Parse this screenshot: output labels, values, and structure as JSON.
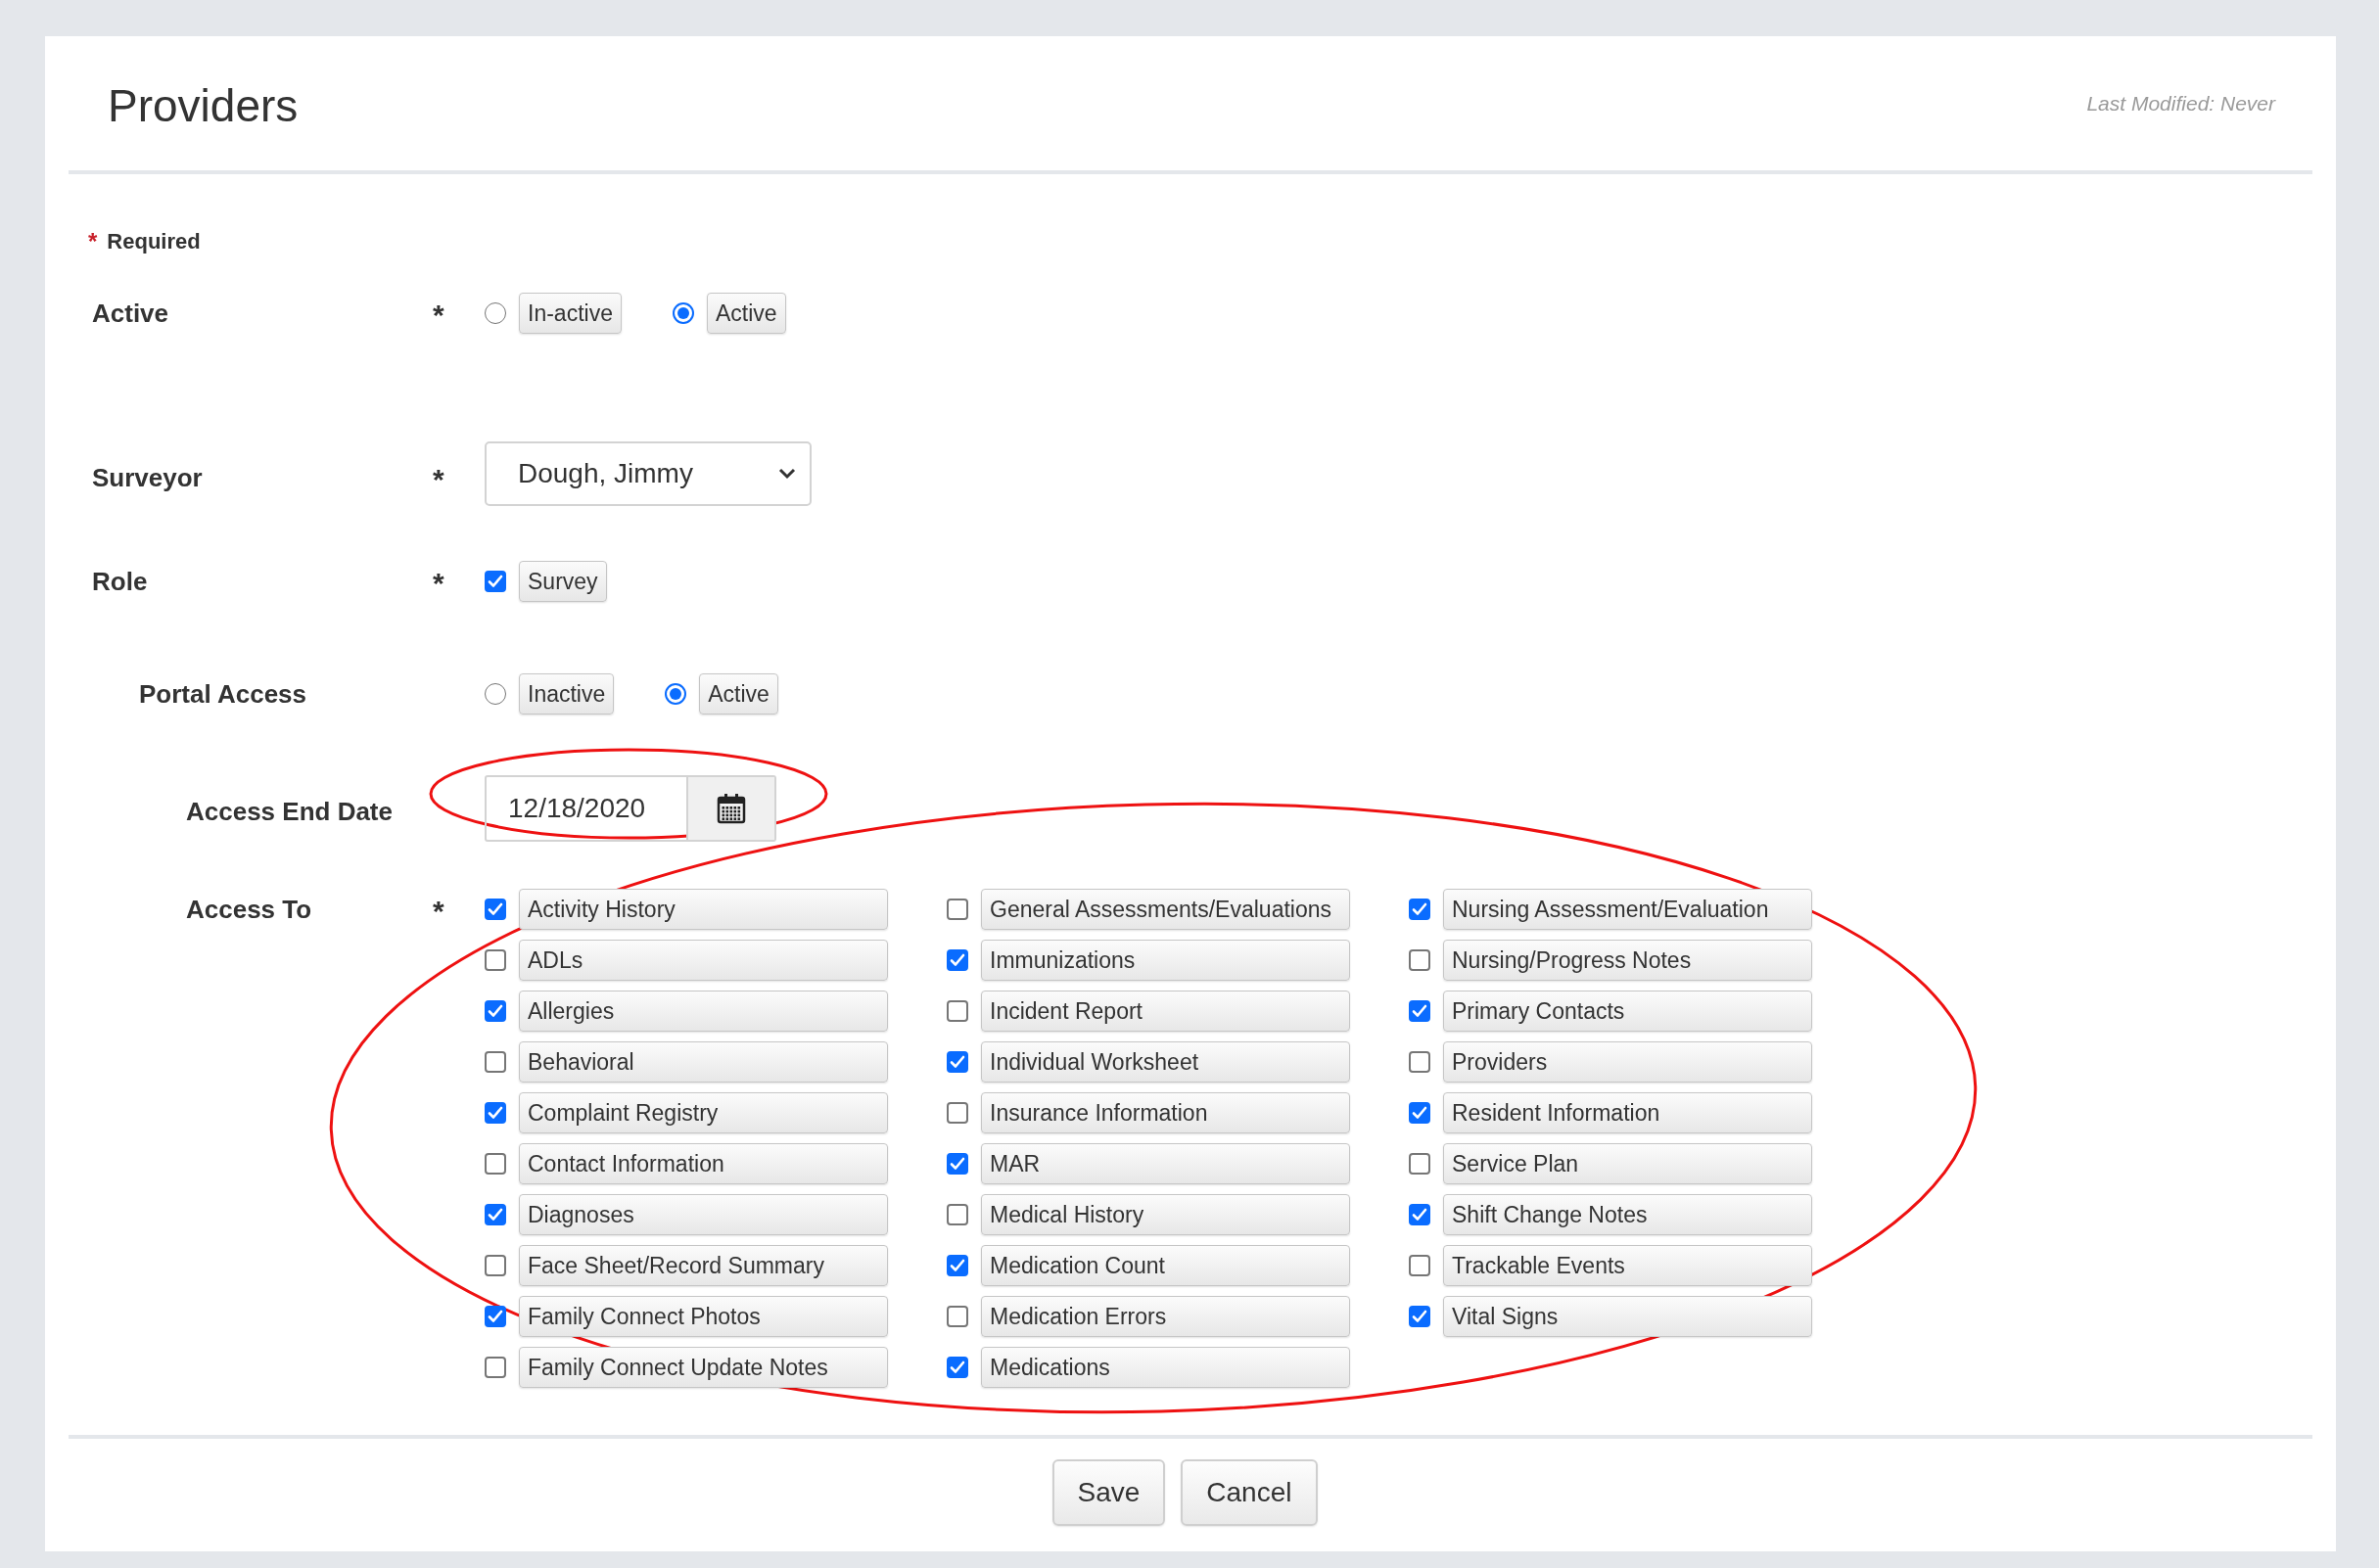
{
  "header": {
    "title": "Providers",
    "last_modified": "Last Modified: Never"
  },
  "required_note": {
    "mark": "*",
    "label": "Required"
  },
  "fields": [
    {
      "kind": "radio",
      "label": "Active",
      "required_mark": "*",
      "options": [
        {
          "label": "In-active",
          "selected": false
        },
        {
          "label": "Active",
          "selected": true
        }
      ]
    },
    {
      "kind": "select",
      "label": "Surveyor",
      "required_mark": "*",
      "value": "Dough, Jimmy"
    },
    {
      "kind": "checkbox",
      "label": "Role",
      "required_mark": "*",
      "options": [
        {
          "label": "Survey",
          "checked": true
        }
      ],
      "children": [
        {
          "kind": "radio",
          "label": "Portal Access",
          "options": [
            {
              "label": "Inactive",
              "selected": false
            },
            {
              "label": "Active",
              "selected": true
            }
          ],
          "children": [
            {
              "kind": "date",
              "label": "Access End Date",
              "value": "12/18/2020"
            },
            {
              "kind": "checkgrid",
              "label": "Access To",
              "required_mark": "*",
              "options": [
                {
                  "label": "Activity History",
                  "checked": true
                },
                {
                  "label": "ADLs",
                  "checked": false
                },
                {
                  "label": "Allergies",
                  "checked": true
                },
                {
                  "label": "Behavioral",
                  "checked": false
                },
                {
                  "label": "Complaint Registry",
                  "checked": true
                },
                {
                  "label": "Contact Information",
                  "checked": false
                },
                {
                  "label": "Diagnoses",
                  "checked": true
                },
                {
                  "label": "Face Sheet/Record Summary",
                  "checked": false
                },
                {
                  "label": "Family Connect Photos",
                  "checked": true
                },
                {
                  "label": "Family Connect Update Notes",
                  "checked": false
                },
                {
                  "label": "General Assessments/Evaluations",
                  "checked": false
                },
                {
                  "label": "Immunizations",
                  "checked": true
                },
                {
                  "label": "Incident Report",
                  "checked": false
                },
                {
                  "label": "Individual Worksheet",
                  "checked": true
                },
                {
                  "label": "Insurance Information",
                  "checked": false
                },
                {
                  "label": "MAR",
                  "checked": true
                },
                {
                  "label": "Medical History",
                  "checked": false
                },
                {
                  "label": "Medication Count",
                  "checked": true
                },
                {
                  "label": "Medication Errors",
                  "checked": false
                },
                {
                  "label": "Medications",
                  "checked": true
                },
                {
                  "label": "Nursing Assessment/Evaluation",
                  "checked": true
                },
                {
                  "label": "Nursing/Progress Notes",
                  "checked": false
                },
                {
                  "label": "Primary Contacts",
                  "checked": true
                },
                {
                  "label": "Providers",
                  "checked": false
                },
                {
                  "label": "Resident Information",
                  "checked": true
                },
                {
                  "label": "Service Plan",
                  "checked": false
                },
                {
                  "label": "Shift Change Notes",
                  "checked": true
                },
                {
                  "label": "Trackable Events",
                  "checked": false
                },
                {
                  "label": "Vital Signs",
                  "checked": true
                }
              ]
            }
          ]
        }
      ]
    }
  ],
  "buttons": [
    {
      "label": "Save"
    },
    {
      "label": "Cancel"
    }
  ]
}
